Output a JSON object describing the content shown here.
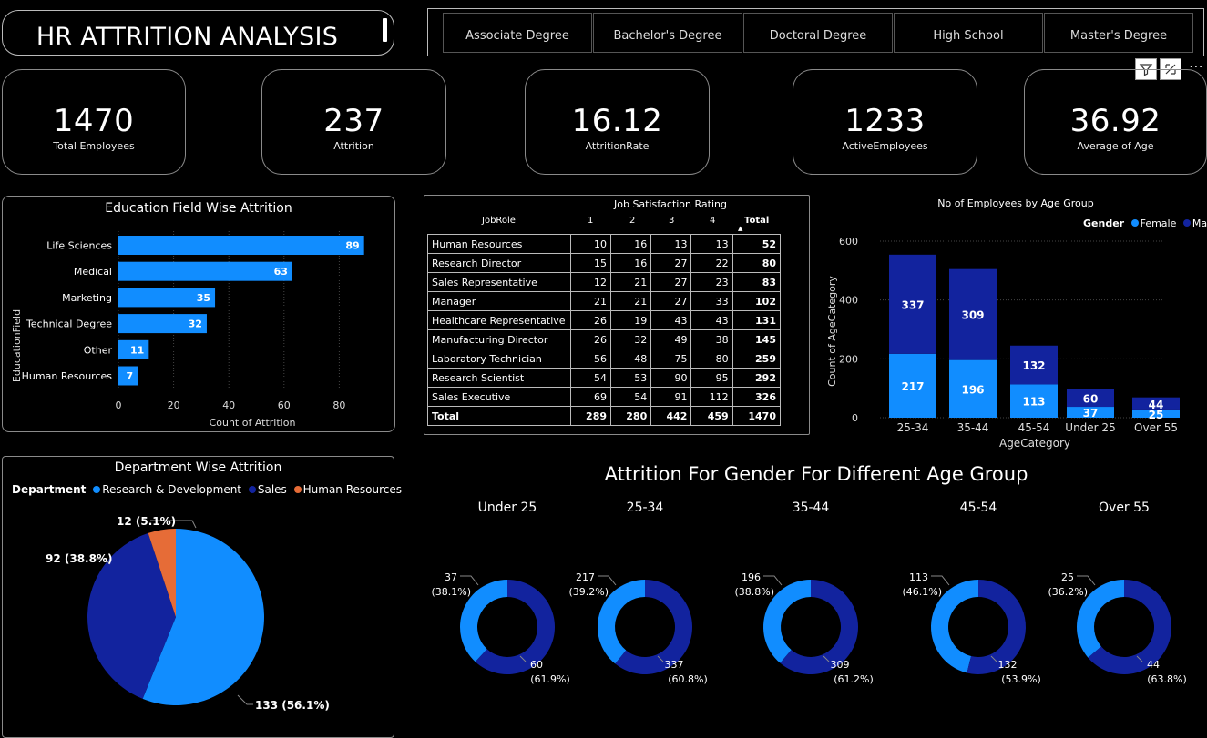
{
  "header": {
    "title": "HR ATTRITION ANALYSIS"
  },
  "slicer": {
    "items": [
      "Associate Degree",
      "Bachelor's Degree",
      "Doctoral Degree",
      "High School",
      "Master's Degree"
    ]
  },
  "visual_icons": {
    "filter": "filter-icon",
    "focus": "focus-mode-icon",
    "more": "more-options-icon"
  },
  "kpis": [
    {
      "value": "1470",
      "label": "Total Employees"
    },
    {
      "value": "237",
      "label": "Attrition"
    },
    {
      "value": "16.12",
      "label": "AttritionRate"
    },
    {
      "value": "1233",
      "label": "ActiveEmployees"
    },
    {
      "value": "36.92",
      "label": "Average of Age"
    }
  ],
  "colors": {
    "female": "#118dff",
    "male": "#12239e",
    "hr": "#e66c37",
    "bg": "#000000"
  },
  "education_chart": {
    "title": "Education Field Wise Attrition",
    "ylabel": "EducationField",
    "xlabel": "Count of Attrition",
    "ticks": [
      "0",
      "20",
      "40",
      "60",
      "80"
    ]
  },
  "job_table": {
    "title": "Job Satisfaction Rating",
    "header": {
      "role": "JobRole",
      "cols": [
        "1",
        "2",
        "3",
        "4"
      ],
      "total": "Total"
    },
    "rows": [
      {
        "role": "Human Resources",
        "v": [
          "10",
          "16",
          "13",
          "13"
        ],
        "t": "52"
      },
      {
        "role": "Research Director",
        "v": [
          "15",
          "16",
          "27",
          "22"
        ],
        "t": "80"
      },
      {
        "role": "Sales Representative",
        "v": [
          "12",
          "21",
          "27",
          "23"
        ],
        "t": "83"
      },
      {
        "role": "Manager",
        "v": [
          "21",
          "21",
          "27",
          "33"
        ],
        "t": "102"
      },
      {
        "role": "Healthcare Representative",
        "v": [
          "26",
          "19",
          "43",
          "43"
        ],
        "t": "131"
      },
      {
        "role": "Manufacturing Director",
        "v": [
          "26",
          "32",
          "49",
          "38"
        ],
        "t": "145"
      },
      {
        "role": "Laboratory Technician",
        "v": [
          "56",
          "48",
          "75",
          "80"
        ],
        "t": "259"
      },
      {
        "role": "Research Scientist",
        "v": [
          "54",
          "53",
          "90",
          "95"
        ],
        "t": "292"
      },
      {
        "role": "Sales Executive",
        "v": [
          "69",
          "54",
          "91",
          "112"
        ],
        "t": "326"
      }
    ],
    "total_row": {
      "role": "Total",
      "v": [
        "289",
        "280",
        "442",
        "459"
      ],
      "t": "1470"
    }
  },
  "age_chart": {
    "title": "No of Employees by Age Group",
    "legend_title": "Gender",
    "legend": [
      "Female",
      "Male"
    ],
    "ylabel": "Count of AgeCategory",
    "xlabel": "AgeCategory",
    "ticks": [
      "0",
      "200",
      "400",
      "600"
    ]
  },
  "dept_chart": {
    "title": "Department Wise Attrition",
    "legend_title": "Department",
    "legend": [
      "Research & Development",
      "Sales",
      "Human Resources"
    ],
    "labels": {
      "hr": "12 (5.1%)",
      "sales": "92 (38.8%)",
      "rd": "133 (56.1%)"
    }
  },
  "gender_section": {
    "title": "Attrition For Gender For Different Age Group",
    "groups": [
      {
        "name": "Under 25",
        "f": "37",
        "fp": "(38.1%)",
        "m": "60",
        "mp": "(61.9%)"
      },
      {
        "name": "25-34",
        "f": "217",
        "fp": "(39.2%)",
        "m": "337",
        "mp": "(60.8%)"
      },
      {
        "name": "35-44",
        "f": "196",
        "fp": "(38.8%)",
        "m": "309",
        "mp": "(61.2%)"
      },
      {
        "name": "45-54",
        "f": "113",
        "fp": "(46.1%)",
        "m": "132",
        "mp": "(53.9%)"
      },
      {
        "name": "Over 55",
        "f": "25",
        "fp": "(36.2%)",
        "m": "44",
        "mp": "(63.8%)"
      }
    ]
  },
  "chart_data": [
    {
      "type": "bar",
      "orientation": "horizontal",
      "title": "Education Field Wise Attrition",
      "xlabel": "Count of Attrition",
      "ylabel": "EducationField",
      "categories": [
        "Life Sciences",
        "Medical",
        "Marketing",
        "Technical Degree",
        "Other",
        "Human Resources"
      ],
      "values": [
        89,
        63,
        35,
        32,
        11,
        7
      ],
      "xlim": [
        0,
        90
      ],
      "grid": true
    },
    {
      "type": "bar",
      "stacked": true,
      "title": "No of Employees by Age Group",
      "xlabel": "AgeCategory",
      "ylabel": "Count of AgeCategory",
      "categories": [
        "25-34",
        "35-44",
        "45-54",
        "Under 25",
        "Over 55"
      ],
      "series": [
        {
          "name": "Female",
          "values": [
            217,
            196,
            113,
            37,
            25
          ]
        },
        {
          "name": "Male",
          "values": [
            337,
            309,
            132,
            60,
            44
          ]
        }
      ],
      "ylim": [
        0,
        600
      ],
      "legend": "top-right",
      "grid": true
    },
    {
      "type": "pie",
      "title": "Department Wise Attrition",
      "categories": [
        "Research & Development",
        "Sales",
        "Human Resources"
      ],
      "values": [
        133,
        92,
        12
      ],
      "legend": "top"
    },
    {
      "type": "pie",
      "donut": true,
      "title": "Attrition For Gender For Different Age Group",
      "groups": [
        "Under 25",
        "25-34",
        "35-44",
        "45-54",
        "Over 55"
      ],
      "series": [
        {
          "name": "Female",
          "values": [
            37,
            217,
            196,
            113,
            25
          ]
        },
        {
          "name": "Male",
          "values": [
            60,
            337,
            309,
            132,
            44
          ]
        }
      ]
    }
  ]
}
